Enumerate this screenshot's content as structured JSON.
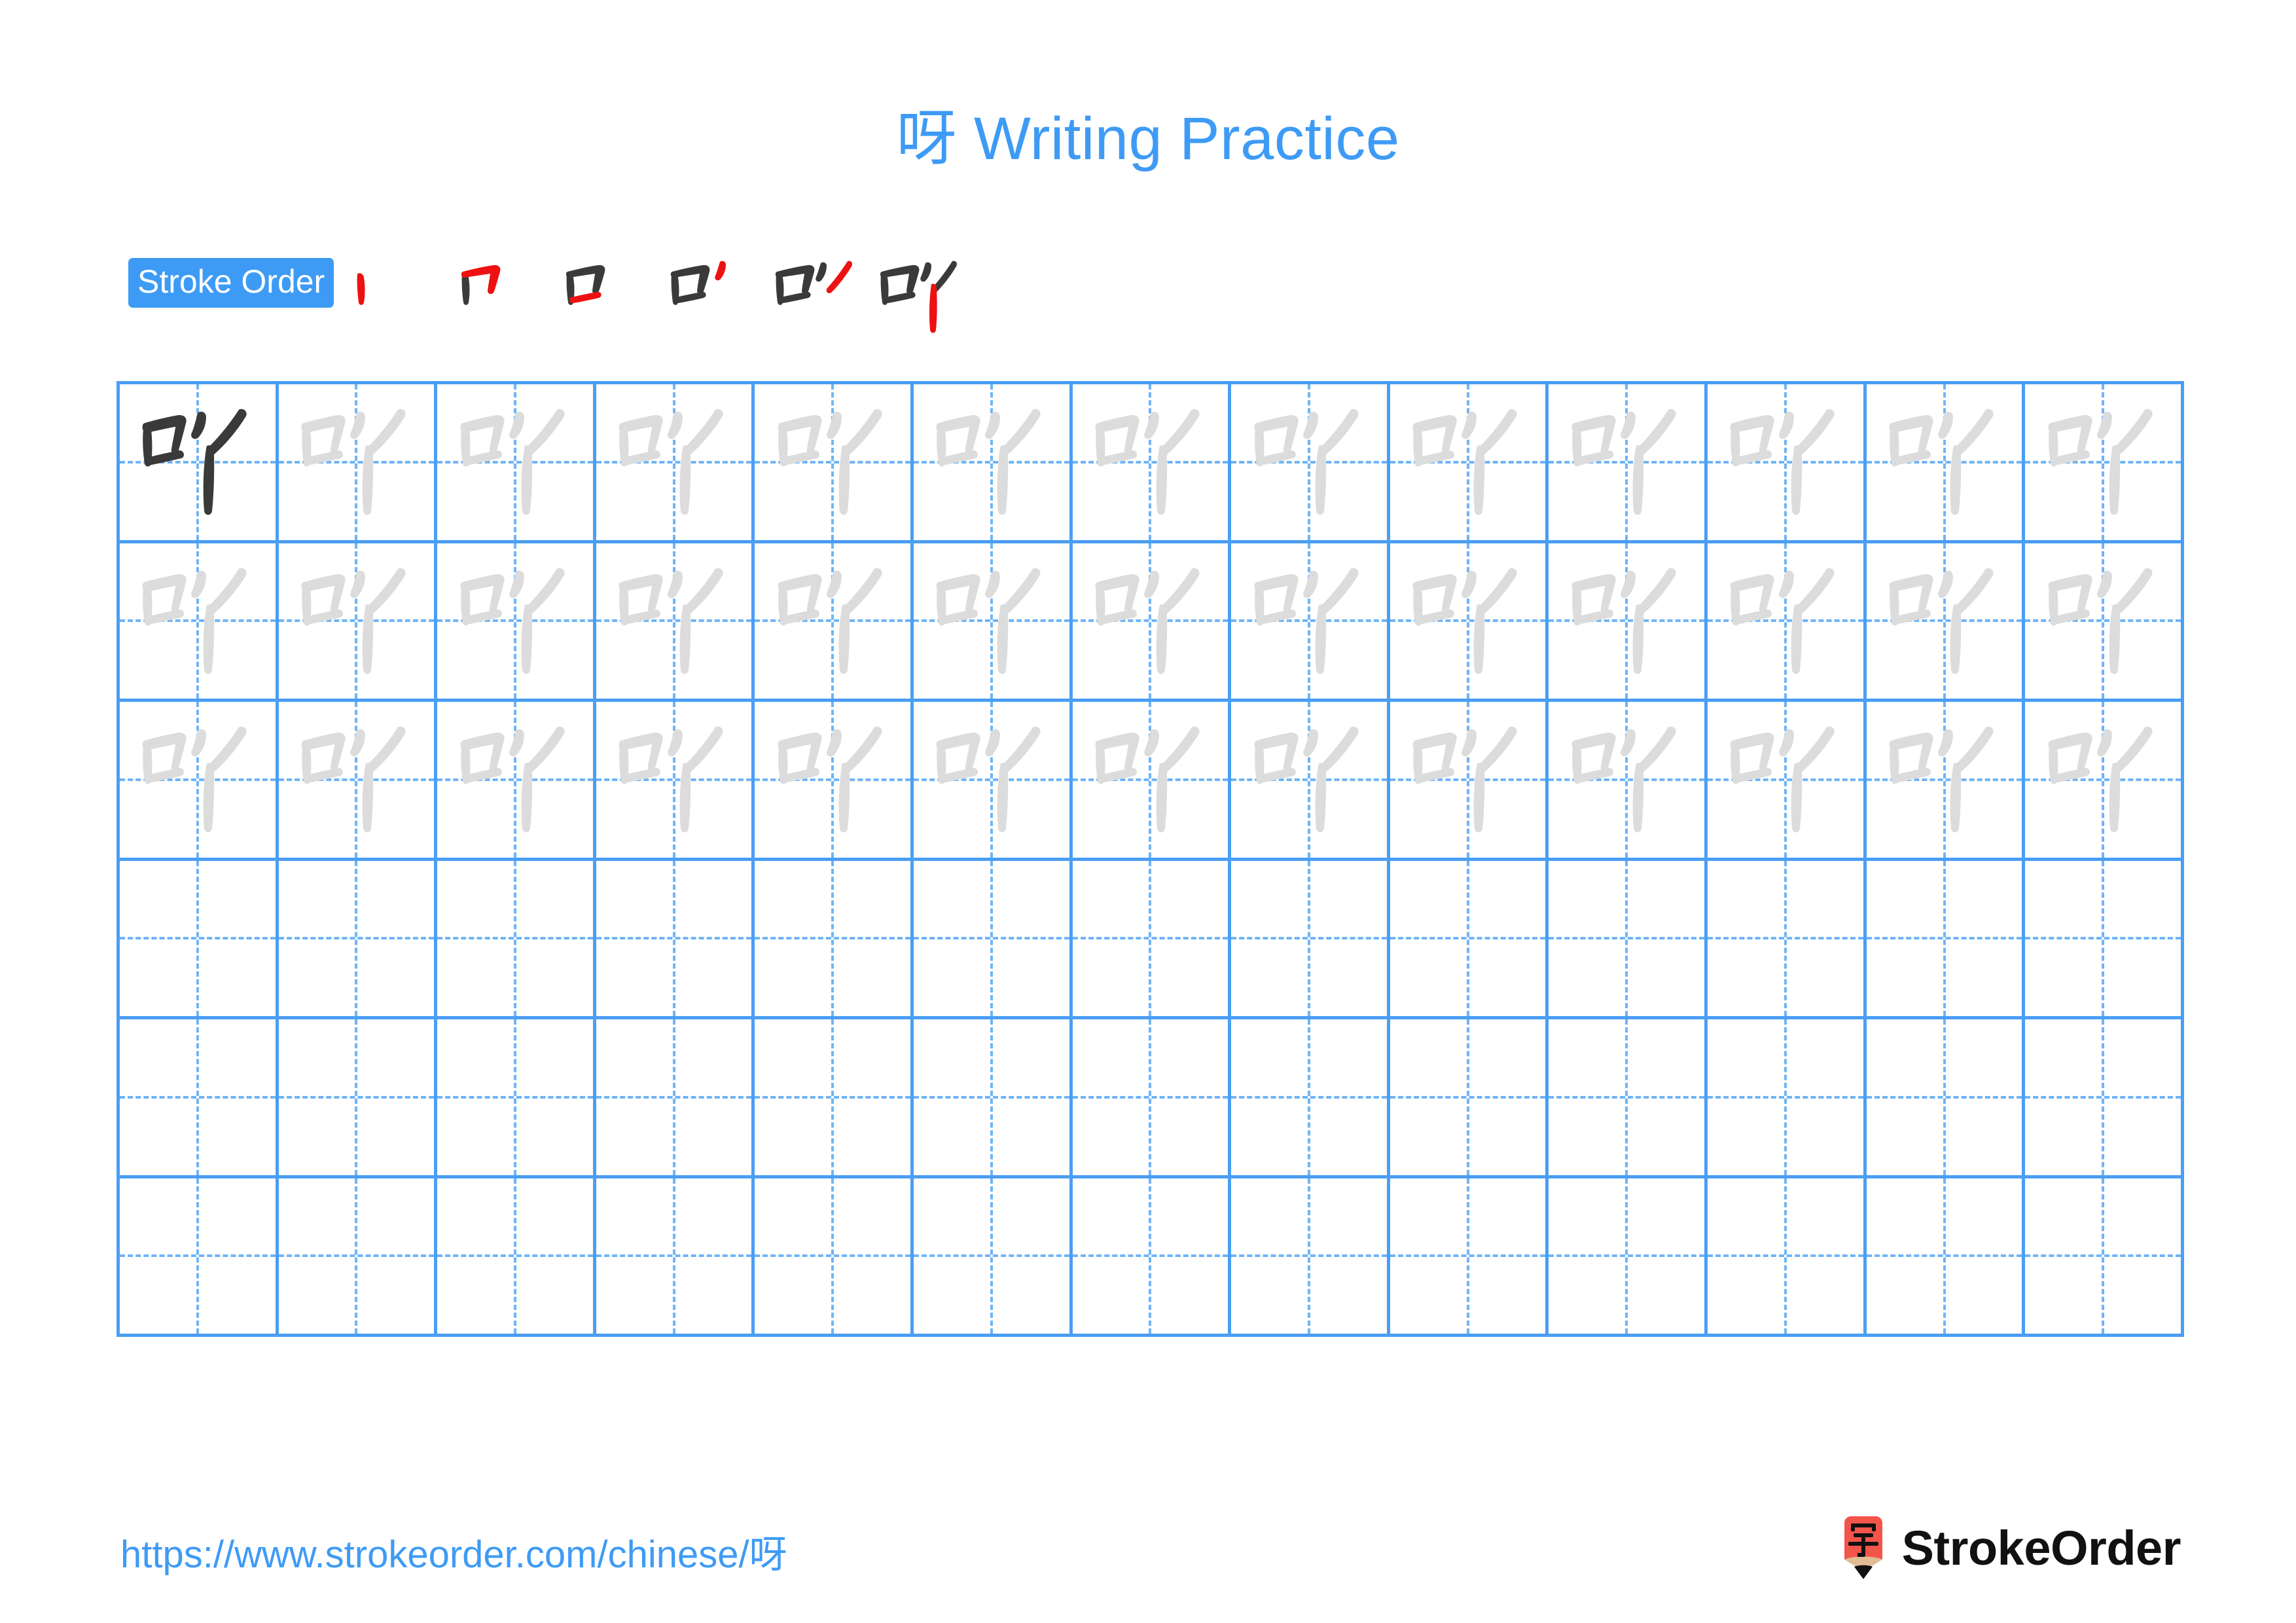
{
  "page": {
    "character": "呀",
    "title": "呀 Writing Practice",
    "background_color": "#FFFFFF",
    "accent_color": "#3E9BF5",
    "grid_line_color": "#4A9EF5",
    "grid_dash_color": "#6FB4F7",
    "model_glyph_color": "#3A3A3A",
    "trace_glyph_color": "#DCDCDC",
    "stroke_new_color": "#EE1111",
    "stroke_old_color": "#3A3A3A"
  },
  "stroke_order": {
    "label": "Stroke Order",
    "total_strokes": 6,
    "steps": [
      {
        "index": 1,
        "name": "stroke-step-1",
        "new_stroke": "vertical (竖)"
      },
      {
        "index": 2,
        "name": "stroke-step-2",
        "new_stroke": "horizontal-hook (横折)"
      },
      {
        "index": 3,
        "name": "stroke-step-3",
        "new_stroke": "horizontal (横)"
      },
      {
        "index": 4,
        "name": "stroke-step-4",
        "new_stroke": "dot / short-throw (撇)"
      },
      {
        "index": 5,
        "name": "stroke-step-5",
        "new_stroke": "press-right (捺)"
      },
      {
        "index": 6,
        "name": "stroke-step-6",
        "new_stroke": "vertical (竖)"
      }
    ]
  },
  "practice_grid": {
    "columns": 13,
    "rows": 6,
    "filled_rows": 3,
    "empty_rows": 3,
    "cells": [
      [
        "model",
        "trace",
        "trace",
        "trace",
        "trace",
        "trace",
        "trace",
        "trace",
        "trace",
        "trace",
        "trace",
        "trace",
        "trace"
      ],
      [
        "trace",
        "trace",
        "trace",
        "trace",
        "trace",
        "trace",
        "trace",
        "trace",
        "trace",
        "trace",
        "trace",
        "trace",
        "trace"
      ],
      [
        "trace",
        "trace",
        "trace",
        "trace",
        "trace",
        "trace",
        "trace",
        "trace",
        "trace",
        "trace",
        "trace",
        "trace",
        "trace"
      ],
      [
        "empty",
        "empty",
        "empty",
        "empty",
        "empty",
        "empty",
        "empty",
        "empty",
        "empty",
        "empty",
        "empty",
        "empty",
        "empty"
      ],
      [
        "empty",
        "empty",
        "empty",
        "empty",
        "empty",
        "empty",
        "empty",
        "empty",
        "empty",
        "empty",
        "empty",
        "empty",
        "empty"
      ],
      [
        "empty",
        "empty",
        "empty",
        "empty",
        "empty",
        "empty",
        "empty",
        "empty",
        "empty",
        "empty",
        "empty",
        "empty",
        "empty"
      ]
    ]
  },
  "footer": {
    "url": "https://www.strokeorder.com/chinese/呀",
    "brand_name": "StrokeOrder",
    "logo_character": "字",
    "logo_body_color": "#F4554A",
    "logo_tip_color": "#E2BC94"
  }
}
